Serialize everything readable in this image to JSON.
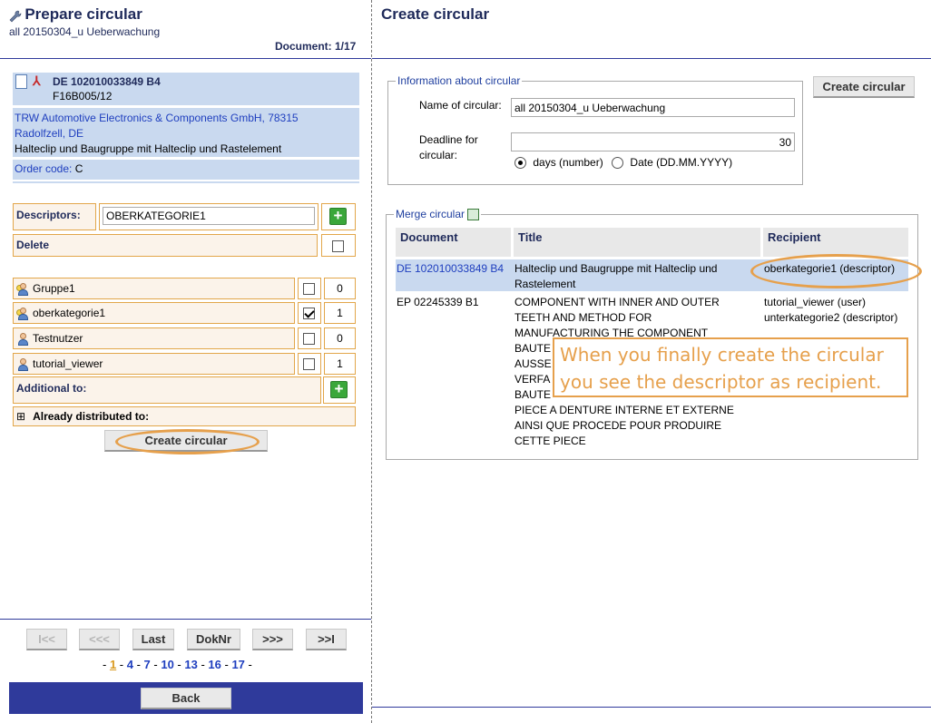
{
  "left": {
    "title": "Prepare circular",
    "subtitle": "all 20150304_u Ueberwachung",
    "document_counter": "Document: 1/17",
    "doc": {
      "number": "DE 102010033849 B4",
      "code": "F16B005/12",
      "applicant": "TRW Automotive Electronics & Components GmbH, 78315 Radolfzell, DE",
      "doc_title": "Halteclip und Baugruppe mit Halteclip und Rastelement",
      "order_code_label": "Order code:",
      "order_code_value": "C"
    },
    "descriptors_label": "Descriptors:",
    "descriptors_value": "OBERKATEGORIE1",
    "delete_label": "Delete",
    "recipients": [
      {
        "name": "Gruppe1",
        "checked": false,
        "count": "0",
        "type": "group"
      },
      {
        "name": "oberkategorie1",
        "checked": true,
        "count": "1",
        "type": "group"
      },
      {
        "name": "Testnutzer",
        "checked": false,
        "count": "0",
        "type": "user"
      },
      {
        "name": "tutorial_viewer",
        "checked": false,
        "count": "1",
        "type": "user"
      }
    ],
    "additional_to_label": "Additional to:",
    "already_distributed_label": "Already distributed to:",
    "expand_symbol": "⊞",
    "create_button": "Create circular",
    "nav": {
      "first": "I<<",
      "prev": "<<<",
      "last": "Last",
      "doknr": "DokNr",
      "next": ">>>",
      "end": ">>I"
    },
    "pages": [
      "1",
      "4",
      "7",
      "10",
      "13",
      "16",
      "17"
    ],
    "back_button": "Back"
  },
  "right": {
    "title": "Create circular",
    "info_legend": "Information about circular",
    "name_label": "Name of circular:",
    "name_value": "all 20150304_u Ueberwachung",
    "deadline_label": "Deadline for circular:",
    "deadline_value": "30",
    "radio_days": "days (number)",
    "radio_date": "Date (DD.MM.YYYY)",
    "create_button": "Create circular",
    "merge_legend": "Merge circular",
    "columns": [
      "Document",
      "Title",
      "Recipient"
    ],
    "rows": [
      {
        "document": "DE 102010033849 B4",
        "title": "Halteclip und Baugruppe mit Halteclip und Rastelement",
        "recipient": "oberkategorie1 (descriptor)"
      },
      {
        "document": "EP 02245339 B1",
        "title_lines": [
          "COMPONENT WITH INNER AND OUTER",
          "TEETH AND METHOD FOR",
          "MANUFACTURING THE COMPONENT",
          "BAUTE",
          "AUSSE",
          "VERFA",
          "BAUTE",
          "PIECE A DENTURE INTERNE ET EXTERNE",
          "AINSI QUE PROCEDE POUR PRODUIRE",
          "CETTE PIECE"
        ],
        "recipients": [
          "tutorial_viewer (user)",
          "unterkategorie2 (descriptor)"
        ]
      }
    ],
    "callout": [
      "When you finally create the circular",
      "you see the descriptor as recipient."
    ]
  },
  "colors": {
    "accent_orange": "#e6a04c",
    "nav_blue": "#2f3a9b",
    "doc_bg": "#c9d9ef",
    "link_blue": "#1f3fbf"
  }
}
